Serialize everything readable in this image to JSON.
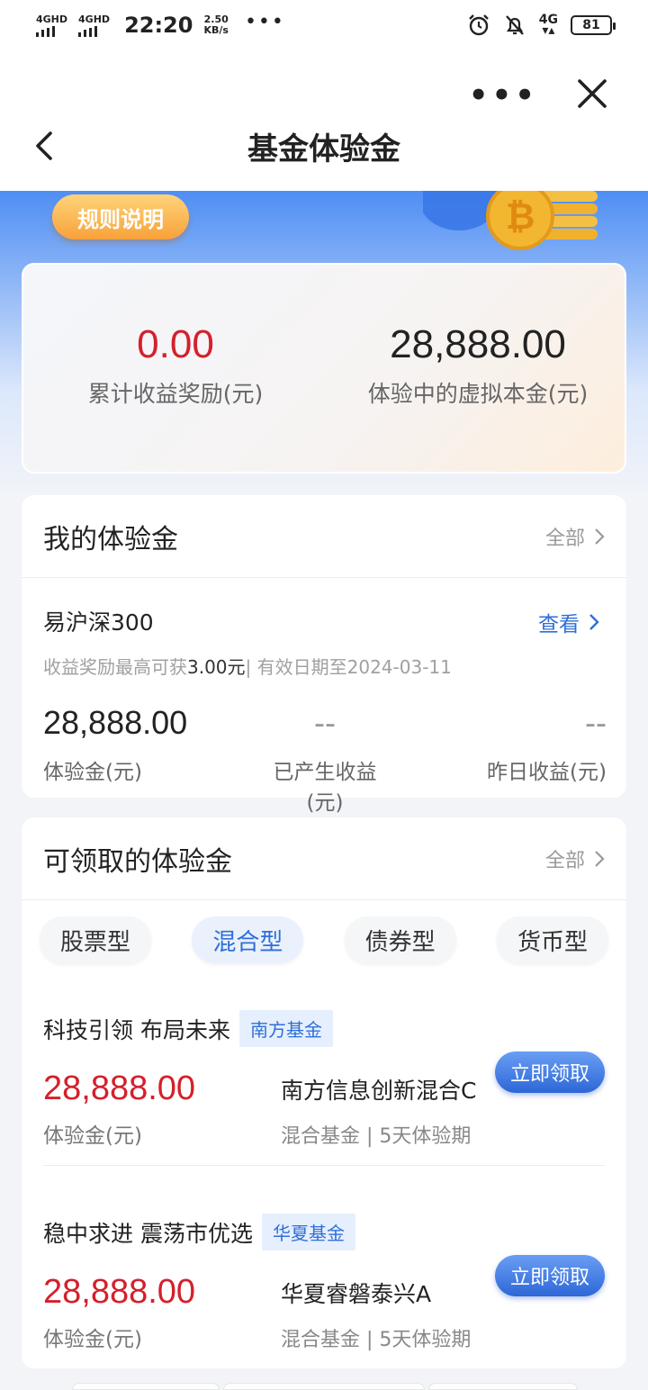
{
  "status_bar": {
    "signal1": "4GHD",
    "signal2": "4GHD",
    "time": "22:20",
    "speed_value": "2.50",
    "speed_unit": "KB/s",
    "network": "4G",
    "battery": "81"
  },
  "header": {
    "title": "基金体验金"
  },
  "banner": {
    "rules_label": "规则说明"
  },
  "summary": {
    "cumulative_value": "0.00",
    "cumulative_label": "累计收益奖励(元)",
    "principal_value": "28,888.00",
    "principal_label": "体验中的虚拟本金(元)"
  },
  "my_section": {
    "title": "我的体验金",
    "all_label": "全部",
    "fund_name": "易沪深300",
    "view_label": "查看",
    "note_prefix": "收益奖励最高可获",
    "note_amount": "3.00元",
    "note_suffix": "| 有效日期至2024-03-11",
    "stats": [
      {
        "value": "28,888.00",
        "label": "体验金(元)"
      },
      {
        "value": "--",
        "label": "已产生收益(元)"
      },
      {
        "value": "--",
        "label": "昨日收益(元)"
      }
    ]
  },
  "available_section": {
    "title": "可领取的体验金",
    "all_label": "全部",
    "tabs": [
      {
        "label": "股票型"
      },
      {
        "label": "混合型"
      },
      {
        "label": "债券型"
      },
      {
        "label": "货币型"
      }
    ],
    "offers": [
      {
        "headline": "科技引领 布局未来",
        "company": "南方基金",
        "amount": "28,888.00",
        "amount_label": "体验金(元)",
        "fund": "南方信息创新混合C",
        "detail": "混合基金 | 5天体验期",
        "button": "立即领取"
      },
      {
        "headline": "稳中求进 震荡市优选",
        "company": "华夏基金",
        "amount": "28,888.00",
        "amount_label": "体验金(元)",
        "fund": "华夏睿磐泰兴A",
        "detail": "混合基金 | 5天体验期",
        "button": "立即领取"
      }
    ]
  }
}
